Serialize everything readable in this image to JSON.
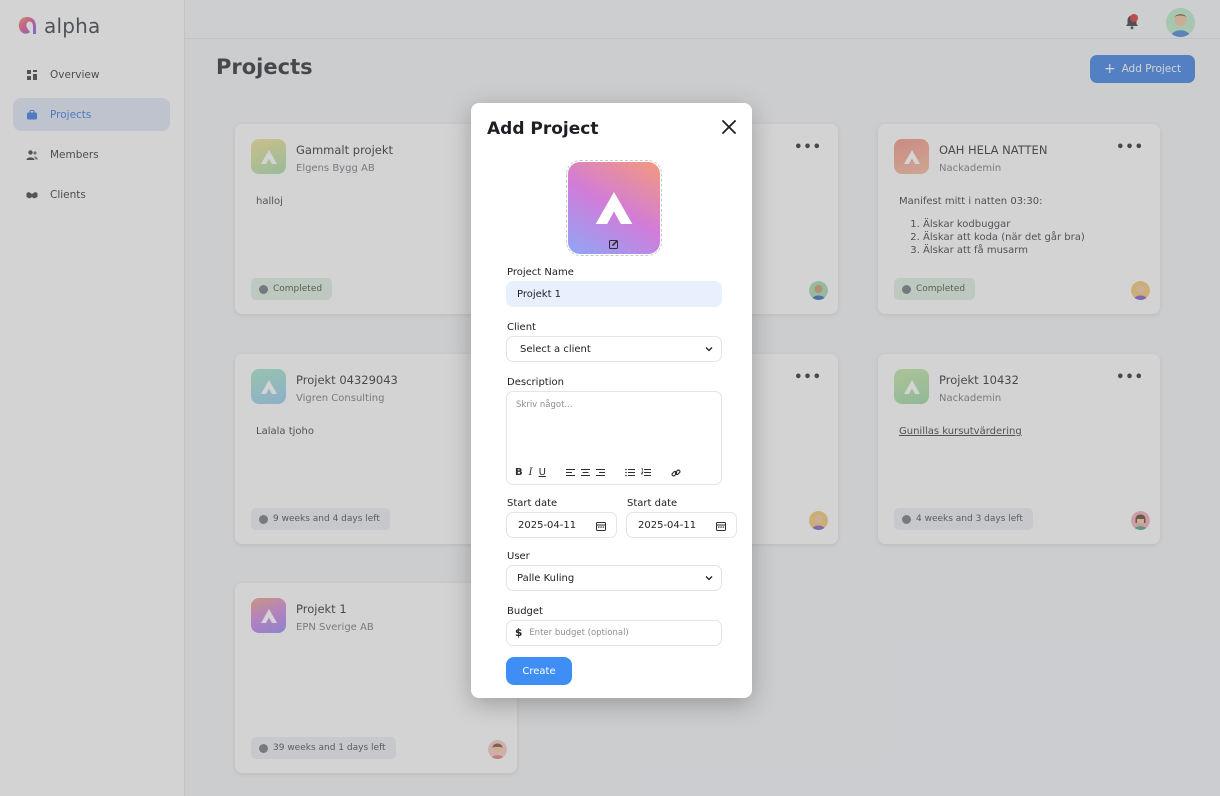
{
  "app": {
    "name": "alpha"
  },
  "sidebar": {
    "items": [
      {
        "label": "Overview",
        "icon": "dashboard-icon"
      },
      {
        "label": "Projects",
        "icon": "briefcase-icon",
        "active": true
      },
      {
        "label": "Members",
        "icon": "users-icon"
      },
      {
        "label": "Clients",
        "icon": "handshake-icon"
      }
    ]
  },
  "header": {
    "notification_icon": "bell-icon",
    "avatar": "user-avatar"
  },
  "page": {
    "title": "Projects",
    "add_button": "Add Project"
  },
  "projects": [
    {
      "title": "Gammalt projekt",
      "client": "Elgens Bygg AB",
      "description": "halloj",
      "status": "Completed",
      "status_type": "done",
      "icon_gradient": [
        "#f0e08a",
        "#9fd9a3"
      ]
    },
    {
      "title": "OAH HELA NATTEN",
      "client": "Nackademin",
      "description": "Manifest mitt i natten 03:30:",
      "list": [
        "Älskar kodbuggar",
        "Älskar att koda (när det går bra)",
        "Älskar att få musarm"
      ],
      "status": "Completed",
      "status_type": "done",
      "icon_gradient": [
        "#f28b7c",
        "#f6b79a"
      ]
    },
    {
      "title": "Projekt 04329043",
      "client": "Vigren Consulting",
      "description": "Lalala tjoho",
      "status": "9 weeks and 4 days left",
      "status_type": "left",
      "icon_gradient": [
        "#9ee6c2",
        "#8fc6f2"
      ]
    },
    {
      "title": "Projekt 10432",
      "client": "Nackademin",
      "description": "Gunillas kursutvärdering",
      "status": "4 weeks and 3 days left",
      "status_type": "left",
      "icon_gradient": [
        "#bfe7a2",
        "#93d49d"
      ]
    },
    {
      "title": "Projekt 1",
      "client": "EPN Sverige AB",
      "description": "",
      "status": "39 weeks and 1 days left",
      "status_type": "left",
      "icon_gradient": [
        "#f09a7e",
        "#8f7cf2"
      ]
    }
  ],
  "modal": {
    "title": "Add Project",
    "project_name_label": "Project Name",
    "project_name_value": "Projekt 1",
    "client_label": "Client",
    "client_value": "Select a client",
    "description_label": "Description",
    "description_placeholder": "Skriv något...",
    "toolbar": [
      "B",
      "I",
      "U"
    ],
    "start_date_label": "Start date",
    "start_date_value": "2025-04-11",
    "end_date_label": "Start date",
    "end_date_value": "2025-04-11",
    "user_label": "User",
    "user_value": "Palle Kuling",
    "budget_label": "Budget",
    "budget_symbol": "$",
    "budget_placeholder": "Enter budget (optional)",
    "create_button": "Create"
  }
}
